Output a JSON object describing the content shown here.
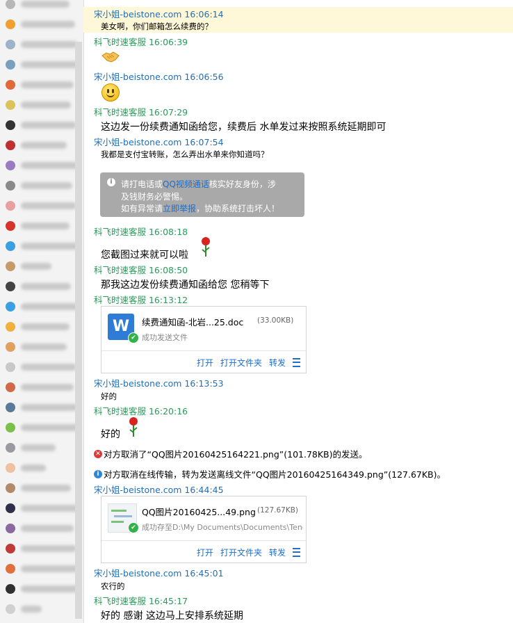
{
  "colors": {
    "sender_self": "#1e6fb8",
    "sender_service": "#2a9a5a",
    "link": "#1a6fd1",
    "highlight": "#fff8d8"
  },
  "sidebar": {
    "contacts": [
      {
        "avatar_color": "#b7b7b7"
      },
      {
        "avatar_color": "#f0a030"
      },
      {
        "avatar_color": "#9fb3c8"
      },
      {
        "avatar_color": "#7aa0c0"
      },
      {
        "avatar_color": "#e06a3a"
      },
      {
        "avatar_color": "#d9c35a"
      },
      {
        "avatar_color": "#333333"
      },
      {
        "avatar_color": "#c03030"
      },
      {
        "avatar_color": "#9a7ac0"
      },
      {
        "avatar_color": "#8a8a8a"
      },
      {
        "avatar_color": "#e7a0a0"
      },
      {
        "avatar_color": "#d8332a"
      },
      {
        "avatar_color": "#3aa0e0"
      },
      {
        "avatar_color": "#c79a6a"
      },
      {
        "avatar_color": "#444444"
      },
      {
        "avatar_color": "#3aa0e0"
      },
      {
        "avatar_color": "#f0b040"
      },
      {
        "avatar_color": "#e0a060"
      },
      {
        "avatar_color": "#c8c8c8"
      },
      {
        "avatar_color": "#d06a4a"
      },
      {
        "avatar_color": "#5a7a9a"
      },
      {
        "avatar_color": "#7ac04a"
      },
      {
        "avatar_color": "#9a9aa0"
      },
      {
        "avatar_color": "#f0c0a0"
      },
      {
        "avatar_color": "#b08a6a"
      },
      {
        "avatar_color": "#30304a"
      },
      {
        "avatar_color": "#8a6aa0"
      },
      {
        "avatar_color": "#c03a3a"
      },
      {
        "avatar_color": "#e07040"
      },
      {
        "avatar_color": "#303030"
      },
      {
        "avatar_color": "#d0d0d0"
      }
    ]
  },
  "chat": {
    "m1_sender": "宋小姐-beistone.com 16:06:14",
    "m1_text": "美女啊，你们邮箱怎么续费的？",
    "m2_sender": "科飞时速客服 16:06:39",
    "m2_emoji": "handshake-emoji",
    "m3_sender": "宋小姐-beistone.com 16:06:56",
    "m3_emoji": "smile-emoji",
    "m4_sender": "科飞时速客服 16:07:29",
    "m4_text": "这边发一份续费通知函给您，续费后 水单发过来按照系统延期即可",
    "m5_sender": "宋小姐-beistone.com 16:07:54",
    "m5_text": "我都是支付宝转账，怎么弄出水单来你知道吗？",
    "warning": {
      "line1_a": "请打电话或",
      "line1_link": "QQ视频通话",
      "line1_b": "核实好友身份，涉",
      "line2": "及钱财务必警惕。",
      "line3_a": "如有异常请",
      "line3_link": "立即举报",
      "line3_b": "，协助系统打击坏人！"
    },
    "m6_sender": "科飞时速客服 16:08:18",
    "m6_text": "您截图过来就可以啦",
    "m7_sender": "科飞时速客服 16:08:50",
    "m7_text": "那我这边发份续费通知函给您 您稍等下",
    "m8_sender": "科飞时速客服 16:13:12",
    "file1": {
      "icon_letter": "W",
      "name": "续费通知函-北岩...25.doc",
      "size": "(33.00KB)",
      "status": "成功发送文件",
      "open": "打开",
      "open_folder": "打开文件夹",
      "forward": "转发"
    },
    "m9_sender": "宋小姐-beistone.com 16:13:53",
    "m9_text": "好的",
    "m10_sender": "科飞时速客服 16:20:16",
    "m10_text": "好的",
    "sys1": "对方取消了“QQ图片20160425164221.png”(101.78KB)的发送。",
    "sys2": "对方取消在线传输，转为发送离线文件“QQ图片20160425164349.png”(127.67KB)。",
    "m11_sender": "宋小姐-beistone.com 16:44:45",
    "file2": {
      "name": "QQ图片20160425...49.png",
      "size": "(127.67KB)",
      "status": "成功存至D:\\My Documents\\Documents\\Tence...",
      "open": "打开",
      "open_folder": "打开文件夹",
      "forward": "转发"
    },
    "m12_sender": "宋小姐-beistone.com 16:45:01",
    "m12_text": "农行的",
    "m13_sender": "科飞时速客服 16:45:17",
    "m13_text": "好的  感谢 这边马上安排系统延期"
  }
}
